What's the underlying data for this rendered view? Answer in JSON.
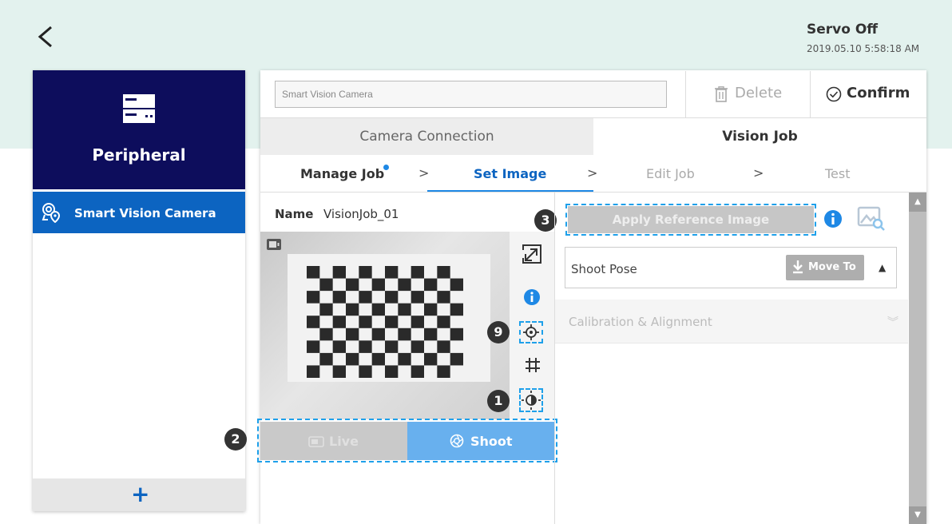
{
  "header": {
    "servo_status": "Servo Off",
    "datetime": "2019.05.10 5:58:18 AM",
    "back_icon": "chevron-left-icon"
  },
  "sidebar": {
    "title": "Peripheral",
    "header_icon": "server-icon",
    "items": [
      {
        "label": "Smart Vision Camera",
        "icon": "camera-location-icon",
        "selected": true
      }
    ],
    "add_icon": "plus-icon",
    "accent_color": "#0d0d5c",
    "selected_color": "#0c64c1"
  },
  "toolbar": {
    "name_value": "Smart Vision Camera",
    "delete_label": "Delete",
    "confirm_label": "Confirm"
  },
  "tabs": [
    {
      "label": "Camera Connection",
      "active": false
    },
    {
      "label": "Vision Job",
      "active": true
    }
  ],
  "steps": [
    {
      "label": "Manage Job",
      "state": "done"
    },
    {
      "label": "Set Image",
      "state": "active"
    },
    {
      "label": "Edit Job",
      "state": "pending"
    },
    {
      "label": "Test",
      "state": "pending"
    }
  ],
  "job": {
    "name_key": "Name",
    "name_value": "VisionJob_01"
  },
  "image_tools": [
    "expand-icon",
    "info-icon",
    "target-icon",
    "grid-icon",
    "contrast-icon"
  ],
  "markers": {
    "m9": "9",
    "m1": "1",
    "m2": "2",
    "m3": "3"
  },
  "capture": {
    "live_label": "Live",
    "shoot_label": "Shoot"
  },
  "right_panel": {
    "apply_label": "Apply Reference Image",
    "shoot_pose_label": "Shoot Pose",
    "move_to_label": "Move To",
    "calibration_label": "Calibration & Alignment"
  },
  "colors": {
    "highlight_dash": "#1ea0ea",
    "active_step": "#0c64c1",
    "topbar_bg": "#e3f2ee"
  }
}
